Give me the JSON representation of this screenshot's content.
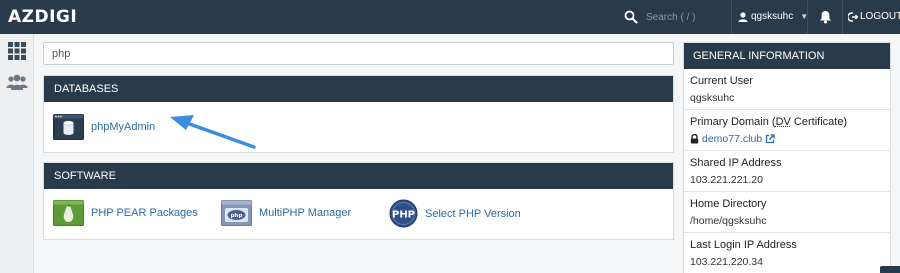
{
  "header": {
    "brand": "AZDIGI",
    "search_placeholder": "Search ( / )",
    "username": "qgsksuhc",
    "logout_label": "LOGOUT"
  },
  "main": {
    "filter_value": "php",
    "databases": {
      "title": "DATABASES",
      "items": [
        {
          "label": "phpMyAdmin",
          "icon": "phpmyadmin-icon"
        }
      ]
    },
    "software": {
      "title": "SOFTWARE",
      "items": [
        {
          "label": "PHP PEAR Packages",
          "icon": "pear-icon"
        },
        {
          "label": "MultiPHP Manager",
          "icon": "multiphp-icon"
        },
        {
          "label": "Select PHP Version",
          "icon": "php-version-icon"
        }
      ]
    }
  },
  "info": {
    "title": "GENERAL INFORMATION",
    "current_user_label": "Current User",
    "current_user": "qgsksuhc",
    "primary_domain_label_pre": "Primary Domain (",
    "primary_domain_label_dv": "DV",
    "primary_domain_label_post": " Certificate)",
    "primary_domain": "demo77.club",
    "shared_ip_label": "Shared IP Address",
    "shared_ip": "103.221.221.20",
    "home_dir_label": "Home Directory",
    "home_dir": "/home/qgsksuhc",
    "last_login_label": "Last Login IP Address",
    "last_login_ip": "103.221.220.34"
  },
  "colors": {
    "header_bg": "#293a4a",
    "link": "#2d6aa6",
    "arrow": "#3b8de0"
  }
}
